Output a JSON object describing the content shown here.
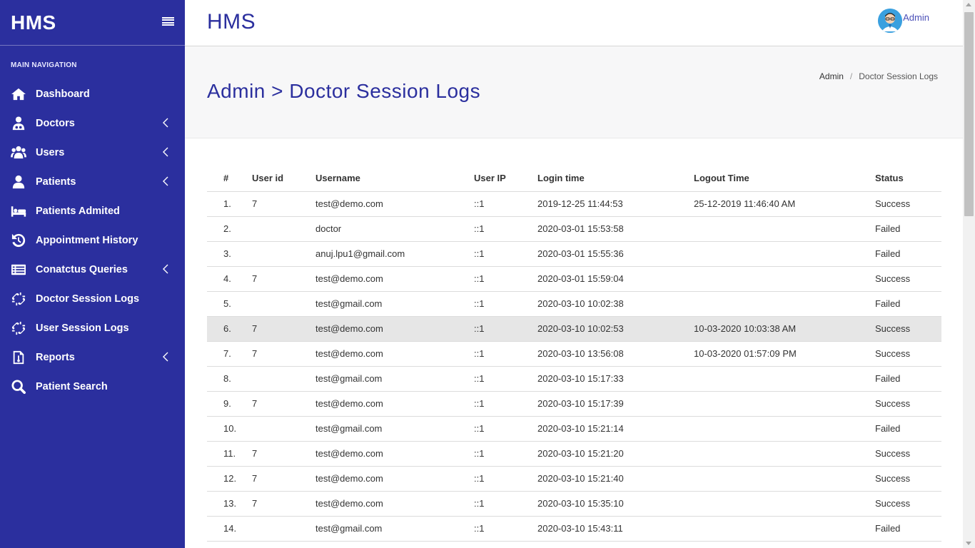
{
  "sidebar": {
    "brand": "HMS",
    "nav_header": "MAIN NAVIGATION",
    "items": [
      {
        "label": "Dashboard",
        "icon": "home-icon",
        "has_arrow": false
      },
      {
        "label": "Doctors",
        "icon": "doctor-icon",
        "has_arrow": true
      },
      {
        "label": "Users",
        "icon": "users-icon",
        "has_arrow": true
      },
      {
        "label": "Patients",
        "icon": "user-icon",
        "has_arrow": true
      },
      {
        "label": "Patients Admited",
        "icon": "bed-icon",
        "has_arrow": false
      },
      {
        "label": "Appointment History",
        "icon": "history-icon",
        "has_arrow": false
      },
      {
        "label": "Conatctus Queries",
        "icon": "list-icon",
        "has_arrow": true
      },
      {
        "label": "Doctor Session Logs",
        "icon": "unlink-icon",
        "has_arrow": false
      },
      {
        "label": "User Session Logs",
        "icon": "unlink-icon",
        "has_arrow": false
      },
      {
        "label": "Reports",
        "icon": "report-icon",
        "has_arrow": true
      },
      {
        "label": "Patient Search",
        "icon": "search-icon",
        "has_arrow": false
      }
    ]
  },
  "header": {
    "title": "HMS",
    "user_name": "Admin"
  },
  "page": {
    "title": "Admin > Doctor Session Logs",
    "breadcrumb": [
      "Admin",
      "Doctor Session Logs"
    ]
  },
  "table": {
    "columns": [
      "#",
      "User id",
      "Username",
      "User IP",
      "Login time",
      "Logout Time",
      "Status"
    ],
    "highlighted_row": 5,
    "rows": [
      [
        "1.",
        "7",
        "test@demo.com",
        "::1",
        "2019-12-25 11:44:53",
        "25-12-2019 11:46:40 AM",
        "Success"
      ],
      [
        "2.",
        "",
        "doctor",
        "::1",
        "2020-03-01 15:53:58",
        "",
        "Failed"
      ],
      [
        "3.",
        "",
        "anuj.lpu1@gmail.com",
        "::1",
        "2020-03-01 15:55:36",
        "",
        "Failed"
      ],
      [
        "4.",
        "7",
        "test@demo.com",
        "::1",
        "2020-03-01 15:59:04",
        "",
        "Success"
      ],
      [
        "5.",
        "",
        "test@gmail.com",
        "::1",
        "2020-03-10 10:02:38",
        "",
        "Failed"
      ],
      [
        "6.",
        "7",
        "test@demo.com",
        "::1",
        "2020-03-10 10:02:53",
        "10-03-2020 10:03:38 AM",
        "Success"
      ],
      [
        "7.",
        "7",
        "test@demo.com",
        "::1",
        "2020-03-10 13:56:08",
        "10-03-2020 01:57:09 PM",
        "Success"
      ],
      [
        "8.",
        "",
        "test@gmail.com",
        "::1",
        "2020-03-10 15:17:33",
        "",
        "Failed"
      ],
      [
        "9.",
        "7",
        "test@demo.com",
        "::1",
        "2020-03-10 15:17:39",
        "",
        "Success"
      ],
      [
        "10.",
        "",
        "test@gmail.com",
        "::1",
        "2020-03-10 15:21:14",
        "",
        "Failed"
      ],
      [
        "11.",
        "7",
        "test@demo.com",
        "::1",
        "2020-03-10 15:21:20",
        "",
        "Success"
      ],
      [
        "12.",
        "7",
        "test@demo.com",
        "::1",
        "2020-03-10 15:21:40",
        "",
        "Success"
      ],
      [
        "13.",
        "7",
        "test@demo.com",
        "::1",
        "2020-03-10 15:35:10",
        "",
        "Success"
      ],
      [
        "14.",
        "",
        "test@gmail.com",
        "::1",
        "2020-03-10 15:43:11",
        "",
        "Failed"
      ]
    ]
  },
  "colors": {
    "primary": "#2b2f9e",
    "row_highlight": "#e6e6e6"
  }
}
